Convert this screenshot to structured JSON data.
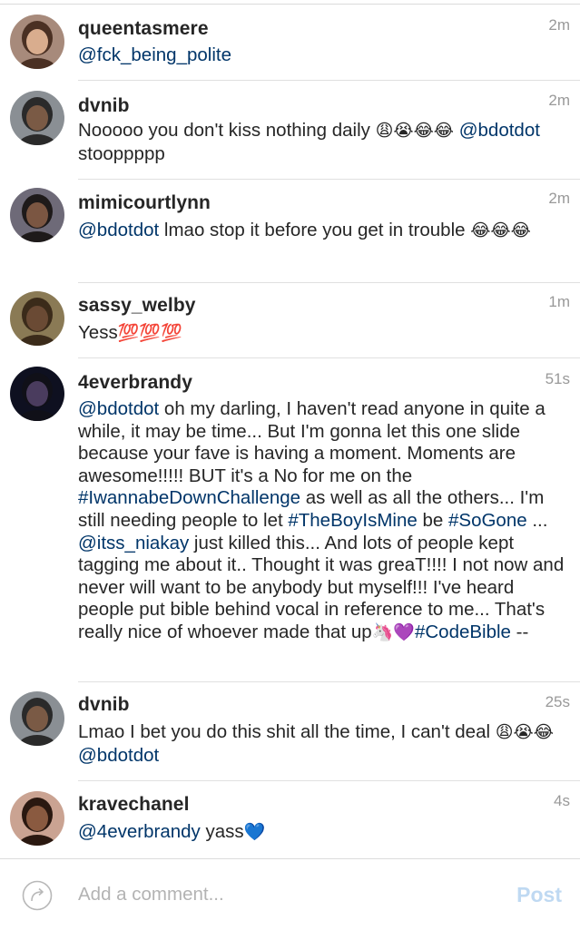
{
  "comments": [
    {
      "username": "queentasmere",
      "time": "2m",
      "avatar": "avatar-photo",
      "tokens": [
        {
          "t": "mention",
          "v": "@fck_being_polite"
        }
      ]
    },
    {
      "username": "dvnib",
      "time": "2m",
      "avatar": "avatar-photo",
      "tokens": [
        {
          "t": "text",
          "v": "Nooooo you don't kiss nothing daily "
        },
        {
          "t": "emoji",
          "v": "😩😭😂😂"
        },
        {
          "t": "text",
          "v": " "
        },
        {
          "t": "mention",
          "v": "@bdotdot"
        },
        {
          "t": "text",
          "v": " stooppppp"
        }
      ]
    },
    {
      "username": "mimicourtlynn",
      "time": "2m",
      "avatar": "avatar-photo",
      "tokens": [
        {
          "t": "mention",
          "v": "@bdotdot"
        },
        {
          "t": "text",
          "v": " lmao stop it before you get in trouble "
        },
        {
          "t": "emoji",
          "v": "😂😂😂"
        }
      ]
    },
    {
      "username": "sassy_welby",
      "time": "1m",
      "avatar": "avatar-photo",
      "tokens": [
        {
          "t": "text",
          "v": "Yess"
        },
        {
          "t": "emoji",
          "v": "💯💯💯"
        }
      ]
    },
    {
      "username": "4everbrandy",
      "time": "51s",
      "avatar": "avatar-photo",
      "tokens": [
        {
          "t": "mention",
          "v": "@bdotdot"
        },
        {
          "t": "text",
          "v": " oh my darling, I haven't read anyone in quite a while, it may be time... But I'm gonna let this one slide because your fave is having a moment. Moments are awesome!!!!! BUT it's a No for me on the "
        },
        {
          "t": "hashtag",
          "v": "#IwannabeDownChallenge"
        },
        {
          "t": "text",
          "v": " as well as all the others... I'm still needing people to let "
        },
        {
          "t": "hashtag",
          "v": "#TheBoyIsMine"
        },
        {
          "t": "text",
          "v": " be "
        },
        {
          "t": "hashtag",
          "v": "#SoGone"
        },
        {
          "t": "text",
          "v": " ... "
        },
        {
          "t": "mention",
          "v": "@itss_niakay"
        },
        {
          "t": "text",
          "v": " just killed this... And lots of people kept tagging me about it.. Thought it was greaT!!!! I not now and never will want to be anybody but myself!!! I've heard people put bible behind vocal in reference to me... That's really nice of whoever made that up"
        },
        {
          "t": "emoji",
          "v": "🦄💜"
        },
        {
          "t": "hashtag",
          "v": "#CodeBible"
        },
        {
          "t": "text",
          "v": " --"
        }
      ]
    },
    {
      "username": "dvnib",
      "time": "25s",
      "avatar": "avatar-photo",
      "tokens": [
        {
          "t": "text",
          "v": "Lmao I bet you do this shit all the time, I can't deal "
        },
        {
          "t": "emoji",
          "v": "😩😭😂"
        },
        {
          "t": "text",
          "v": " "
        },
        {
          "t": "mention",
          "v": "@bdotdot"
        }
      ]
    },
    {
      "username": "kravechanel",
      "time": "4s",
      "avatar": "avatar-photo",
      "tokens": [
        {
          "t": "mention",
          "v": "@4everbrandy"
        },
        {
          "t": "text",
          "v": " yass"
        },
        {
          "t": "emoji",
          "v": "💙"
        }
      ]
    }
  ],
  "footer": {
    "placeholder": "Add a comment...",
    "post_label": "Post",
    "icon": "reply-arrow-icon"
  },
  "colors": {
    "link": "#003569",
    "timestamp": "#999999",
    "post_disabled": "#bfd9f2",
    "divider": "#e0e0e0"
  }
}
